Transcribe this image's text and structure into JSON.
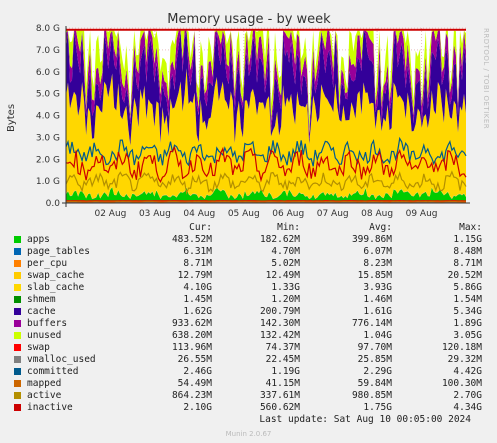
{
  "page": {
    "title": "Memory usage - by week",
    "ylabel": "Bytes",
    "side_text": "RRDTOOL / TOBI OETIKER",
    "last_update": "Last update: Sat Aug 10 00:05:00 2024",
    "version": "Munin 2.0.67",
    "column_headers": {
      "cur": "Cur:",
      "min": "Min:",
      "avg": "Avg:",
      "max": "Max:"
    }
  },
  "chart_data": {
    "type": "area",
    "title": "Memory usage - by week",
    "ylabel": "Bytes",
    "ylim": [
      0,
      8
    ],
    "y_unit": "G",
    "y_ticks": [
      "0.0",
      "1.0 G",
      "2.0 G",
      "3.0 G",
      "4.0 G",
      "5.0 G",
      "6.0 G",
      "7.0 G",
      "8.0 G"
    ],
    "x_ticks": [
      "02 Aug",
      "03 Aug",
      "04 Aug",
      "05 Aug",
      "06 Aug",
      "07 Aug",
      "08 Aug",
      "09 Aug"
    ],
    "grid": true,
    "legend_position": "bottom",
    "series": [
      {
        "name": "apps",
        "color": "#00cc00",
        "cur": "483.52M",
        "min": "182.62M",
        "avg": "399.86M",
        "max": "1.15G"
      },
      {
        "name": "page_tables",
        "color": "#0066b3",
        "cur": "6.31M",
        "min": "4.70M",
        "avg": "6.07M",
        "max": "8.48M"
      },
      {
        "name": "per_cpu",
        "color": "#ff8000",
        "cur": "8.71M",
        "min": "5.02M",
        "avg": "8.23M",
        "max": "8.71M"
      },
      {
        "name": "swap_cache",
        "color": "#ffcc00",
        "cur": "12.79M",
        "min": "12.49M",
        "avg": "15.85M",
        "max": "20.52M"
      },
      {
        "name": "slab_cache",
        "color": "#ffd700",
        "cur": "4.10G",
        "min": "1.33G",
        "avg": "3.93G",
        "max": "5.86G"
      },
      {
        "name": "shmem",
        "color": "#008f00",
        "cur": "1.45M",
        "min": "1.20M",
        "avg": "1.46M",
        "max": "1.54M"
      },
      {
        "name": "cache",
        "color": "#330099",
        "cur": "1.62G",
        "min": "200.79M",
        "avg": "1.61G",
        "max": "5.34G"
      },
      {
        "name": "buffers",
        "color": "#990099",
        "cur": "933.62M",
        "min": "142.30M",
        "avg": "776.14M",
        "max": "1.89G"
      },
      {
        "name": "unused",
        "color": "#ccff00",
        "cur": "638.20M",
        "min": "132.42M",
        "avg": "1.04G",
        "max": "3.05G"
      },
      {
        "name": "swap",
        "color": "#ff0000",
        "cur": "113.96M",
        "min": "74.37M",
        "avg": "97.70M",
        "max": "120.18M"
      },
      {
        "name": "vmalloc_used",
        "color": "#808080",
        "cur": "26.55M",
        "min": "22.45M",
        "avg": "25.85M",
        "max": "29.32M"
      },
      {
        "name": "committed",
        "color": "#005a8c",
        "cur": "2.46G",
        "min": "1.19G",
        "avg": "2.29G",
        "max": "4.42G"
      },
      {
        "name": "mapped",
        "color": "#cc6600",
        "cur": "54.49M",
        "min": "41.15M",
        "avg": "59.84M",
        "max": "100.30M"
      },
      {
        "name": "active",
        "color": "#b38f00",
        "cur": "864.23M",
        "min": "337.61M",
        "avg": "980.85M",
        "max": "2.70G"
      },
      {
        "name": "inactive",
        "color": "#cc0000",
        "cur": "2.10G",
        "min": "560.62M",
        "avg": "1.75G",
        "max": "4.34G"
      }
    ],
    "plot_colors": {
      "background": "#ffffff",
      "grid": "#e8c0c0",
      "frame": "#333333"
    }
  }
}
